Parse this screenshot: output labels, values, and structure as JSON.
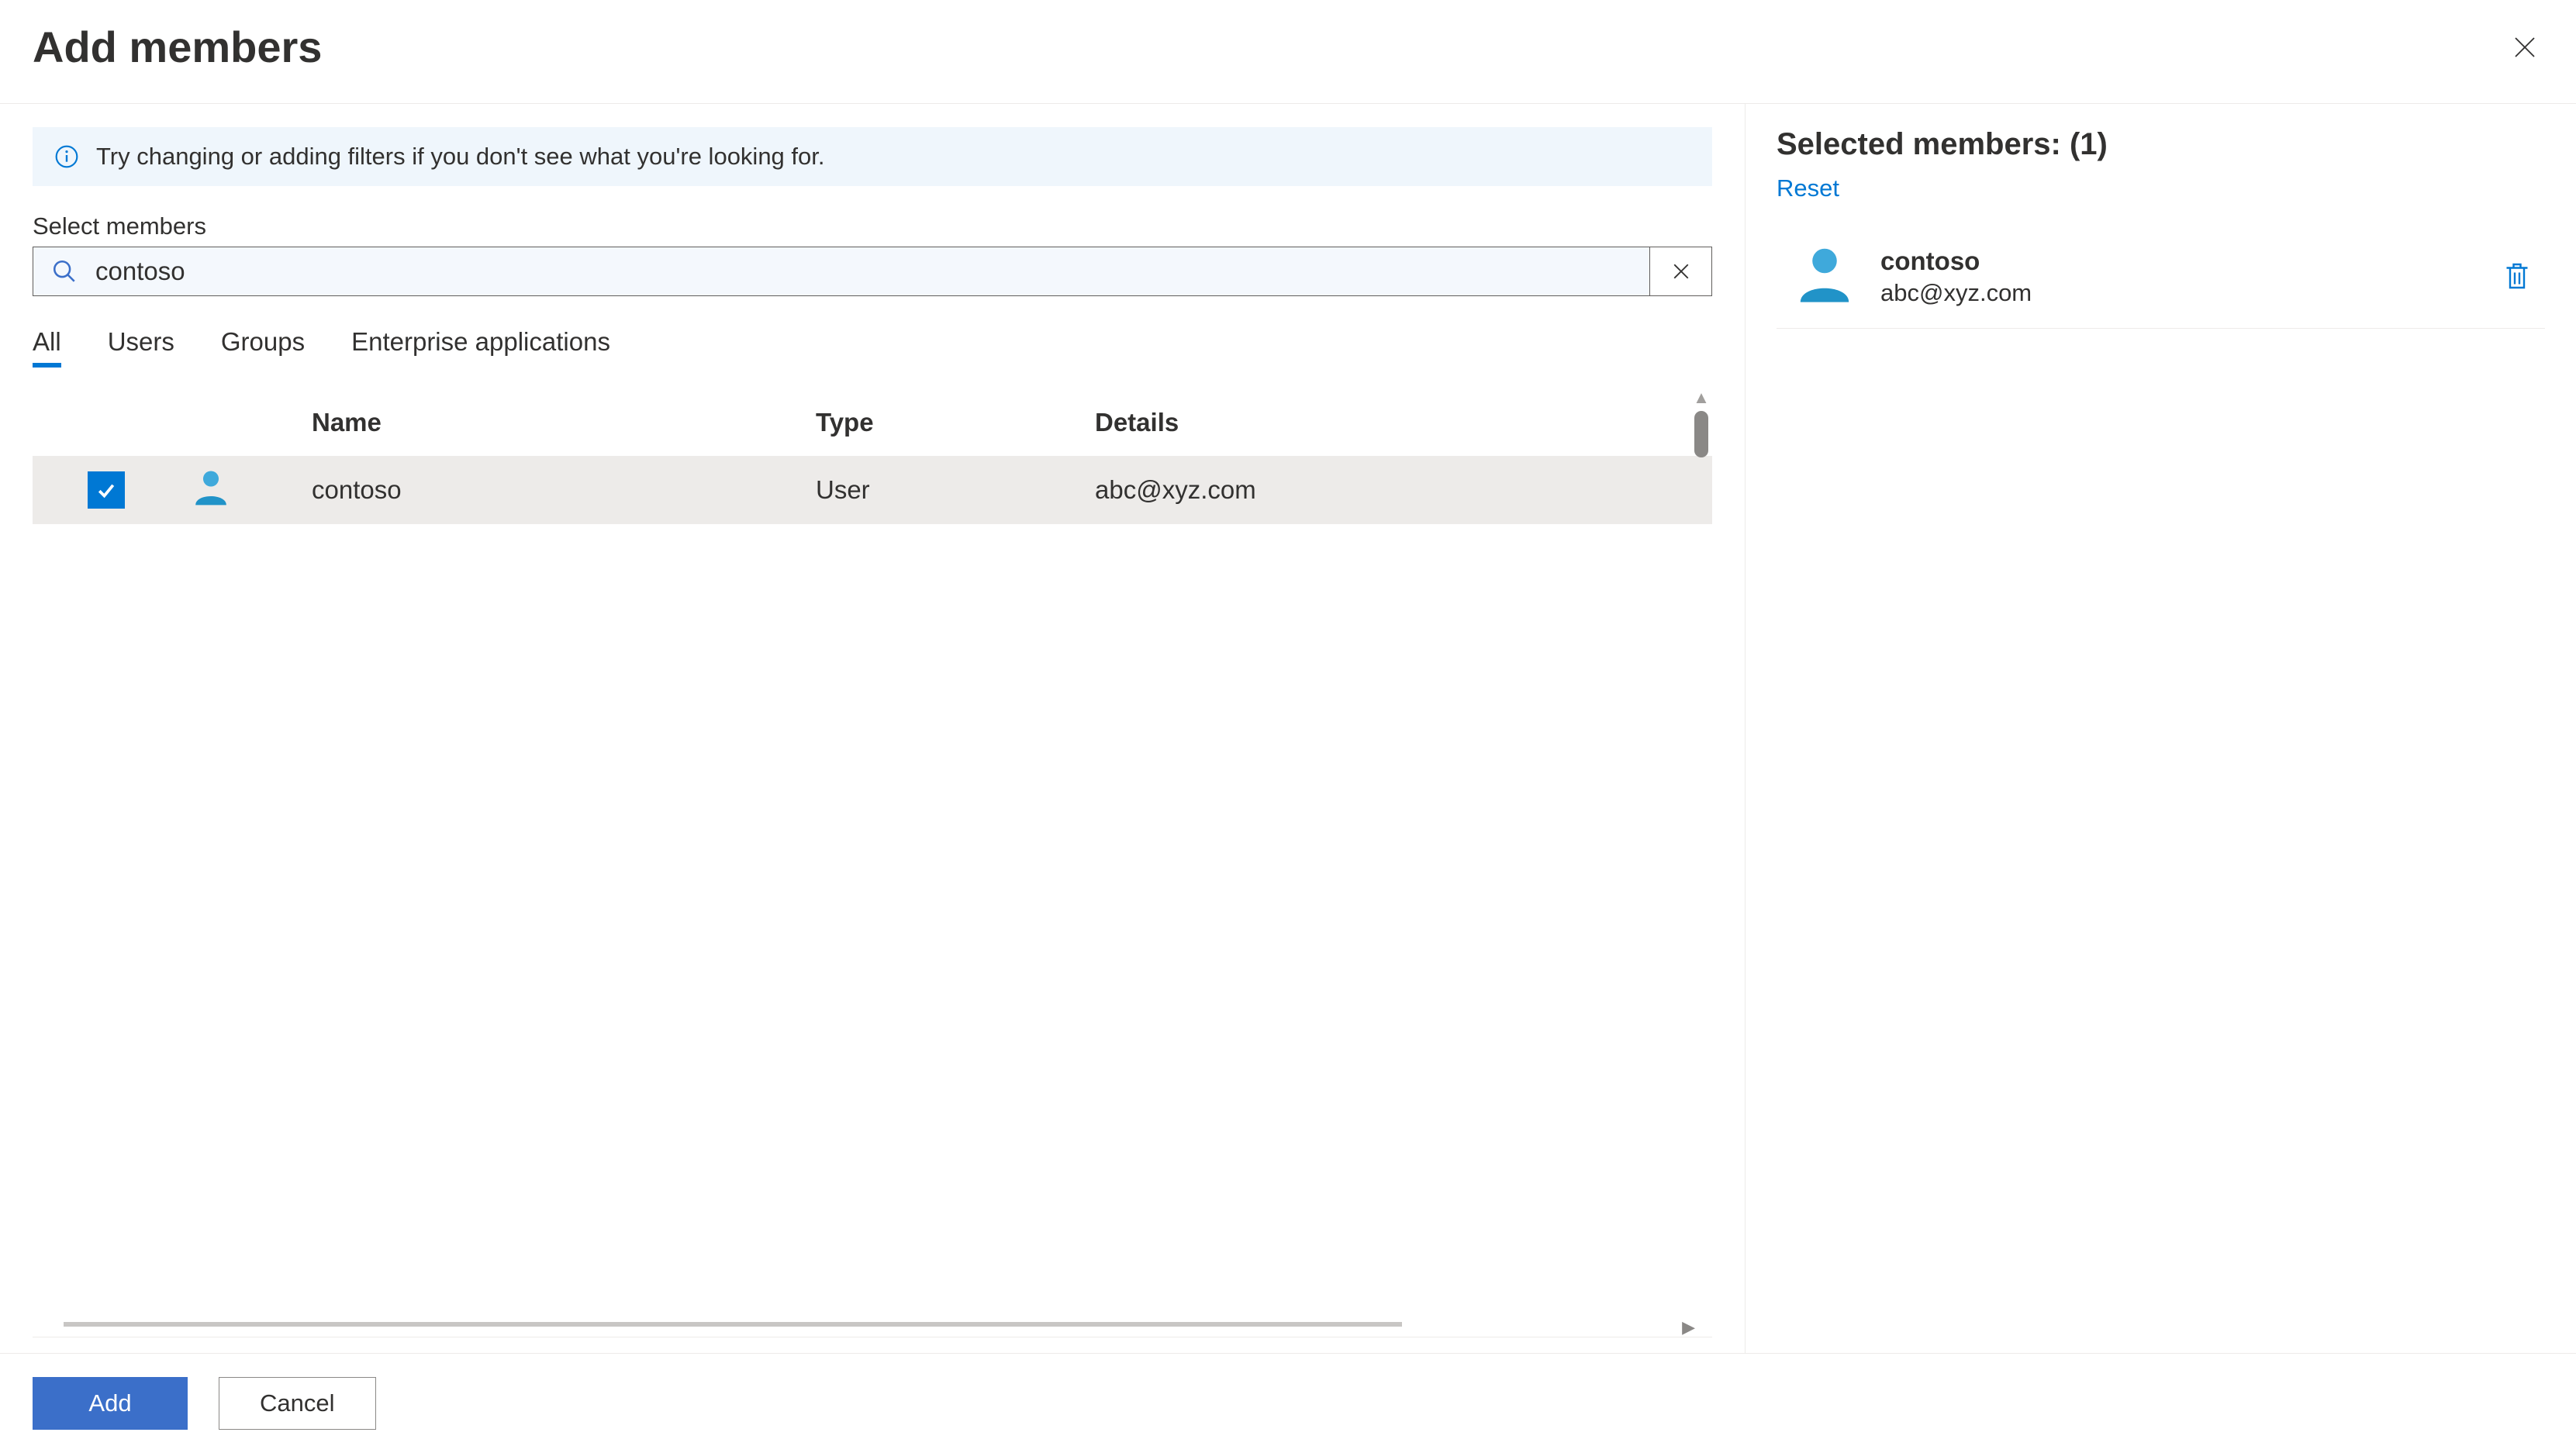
{
  "header": {
    "title": "Add members"
  },
  "info_message": "Try changing or adding filters if you don't see what you're looking for.",
  "search": {
    "label": "Select members",
    "value": "contoso"
  },
  "tabs": [
    {
      "label": "All",
      "active": true
    },
    {
      "label": "Users",
      "active": false
    },
    {
      "label": "Groups",
      "active": false
    },
    {
      "label": "Enterprise applications",
      "active": false
    }
  ],
  "columns": {
    "name": "Name",
    "type": "Type",
    "details": "Details"
  },
  "rows": [
    {
      "name": "contoso",
      "type": "User",
      "details": "abc@xyz.com",
      "selected": true
    }
  ],
  "selected_panel": {
    "title": "Selected members: (1)",
    "reset": "Reset",
    "items": [
      {
        "name": "contoso",
        "sub": "abc@xyz.com"
      }
    ]
  },
  "footer": {
    "add": "Add",
    "cancel": "Cancel"
  },
  "colors": {
    "accent": "#0078d4",
    "info_bg": "#eff6fc"
  }
}
